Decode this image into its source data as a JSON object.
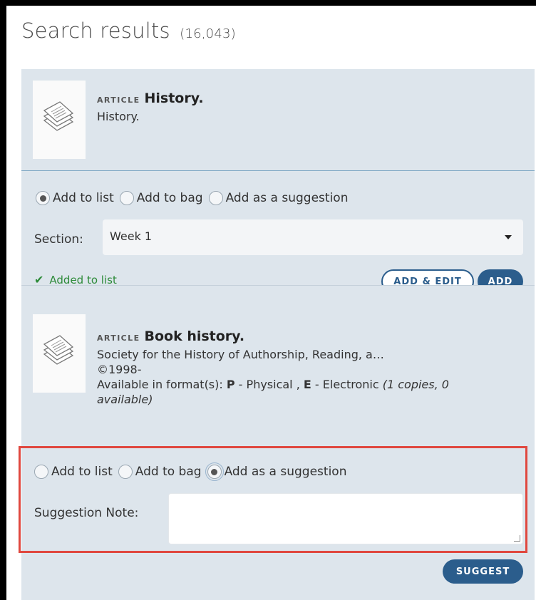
{
  "header": {
    "title": "Search results",
    "count": "(16,043)"
  },
  "results": [
    {
      "type": "ARTICLE",
      "title": "History.",
      "lines": [
        "History."
      ]
    },
    {
      "type": "ARTICLE",
      "title": "Book history.",
      "lines": [
        "Society for the History of Authorship, Reading, a…",
        "©1998-"
      ],
      "availability": {
        "prefix": "Available in format(s): ",
        "p_code": "P",
        "p_text": " - Physical , ",
        "e_code": "E",
        "e_text": " - Electronic ",
        "copies": "(1 copies, 0 available)"
      }
    }
  ],
  "options": {
    "add_to_list": "Add to list",
    "add_to_bag": "Add to bag",
    "add_as_suggestion": "Add as a suggestion"
  },
  "actions1": {
    "selected": "add_to_list",
    "section_label": "Section:",
    "section_value": "Week 1",
    "status": "Added to list",
    "add_edit_label": "ADD & EDIT",
    "add_label": "ADD"
  },
  "actions2": {
    "selected": "add_as_suggestion",
    "note_label": "Suggestion Note:",
    "note_value": "",
    "suggest_label": "SUGGEST"
  },
  "colors": {
    "panel": "#dde5ec",
    "accent": "#2b5d8c",
    "success": "#2e8b3a",
    "highlight": "#e0483f"
  },
  "icons": [
    "document-stack-icon",
    "check-icon",
    "dropdown-caret-icon",
    "resize-grip-icon"
  ]
}
